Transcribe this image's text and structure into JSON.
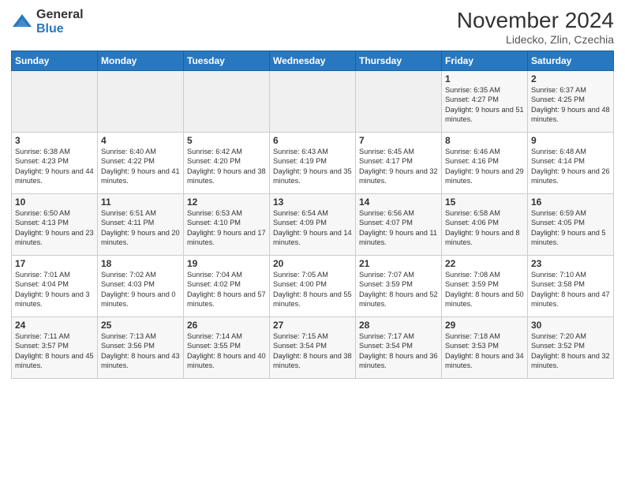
{
  "logo": {
    "general": "General",
    "blue": "Blue"
  },
  "title": "November 2024",
  "subtitle": "Lidecko, Zlin, Czechia",
  "days_of_week": [
    "Sunday",
    "Monday",
    "Tuesday",
    "Wednesday",
    "Thursday",
    "Friday",
    "Saturday"
  ],
  "weeks": [
    [
      {
        "day": "",
        "info": ""
      },
      {
        "day": "",
        "info": ""
      },
      {
        "day": "",
        "info": ""
      },
      {
        "day": "",
        "info": ""
      },
      {
        "day": "",
        "info": ""
      },
      {
        "day": "1",
        "info": "Sunrise: 6:35 AM\nSunset: 4:27 PM\nDaylight: 9 hours and 51 minutes."
      },
      {
        "day": "2",
        "info": "Sunrise: 6:37 AM\nSunset: 4:25 PM\nDaylight: 9 hours and 48 minutes."
      }
    ],
    [
      {
        "day": "3",
        "info": "Sunrise: 6:38 AM\nSunset: 4:23 PM\nDaylight: 9 hours and 44 minutes."
      },
      {
        "day": "4",
        "info": "Sunrise: 6:40 AM\nSunset: 4:22 PM\nDaylight: 9 hours and 41 minutes."
      },
      {
        "day": "5",
        "info": "Sunrise: 6:42 AM\nSunset: 4:20 PM\nDaylight: 9 hours and 38 minutes."
      },
      {
        "day": "6",
        "info": "Sunrise: 6:43 AM\nSunset: 4:19 PM\nDaylight: 9 hours and 35 minutes."
      },
      {
        "day": "7",
        "info": "Sunrise: 6:45 AM\nSunset: 4:17 PM\nDaylight: 9 hours and 32 minutes."
      },
      {
        "day": "8",
        "info": "Sunrise: 6:46 AM\nSunset: 4:16 PM\nDaylight: 9 hours and 29 minutes."
      },
      {
        "day": "9",
        "info": "Sunrise: 6:48 AM\nSunset: 4:14 PM\nDaylight: 9 hours and 26 minutes."
      }
    ],
    [
      {
        "day": "10",
        "info": "Sunrise: 6:50 AM\nSunset: 4:13 PM\nDaylight: 9 hours and 23 minutes."
      },
      {
        "day": "11",
        "info": "Sunrise: 6:51 AM\nSunset: 4:11 PM\nDaylight: 9 hours and 20 minutes."
      },
      {
        "day": "12",
        "info": "Sunrise: 6:53 AM\nSunset: 4:10 PM\nDaylight: 9 hours and 17 minutes."
      },
      {
        "day": "13",
        "info": "Sunrise: 6:54 AM\nSunset: 4:09 PM\nDaylight: 9 hours and 14 minutes."
      },
      {
        "day": "14",
        "info": "Sunrise: 6:56 AM\nSunset: 4:07 PM\nDaylight: 9 hours and 11 minutes."
      },
      {
        "day": "15",
        "info": "Sunrise: 6:58 AM\nSunset: 4:06 PM\nDaylight: 9 hours and 8 minutes."
      },
      {
        "day": "16",
        "info": "Sunrise: 6:59 AM\nSunset: 4:05 PM\nDaylight: 9 hours and 5 minutes."
      }
    ],
    [
      {
        "day": "17",
        "info": "Sunrise: 7:01 AM\nSunset: 4:04 PM\nDaylight: 9 hours and 3 minutes."
      },
      {
        "day": "18",
        "info": "Sunrise: 7:02 AM\nSunset: 4:03 PM\nDaylight: 9 hours and 0 minutes."
      },
      {
        "day": "19",
        "info": "Sunrise: 7:04 AM\nSunset: 4:02 PM\nDaylight: 8 hours and 57 minutes."
      },
      {
        "day": "20",
        "info": "Sunrise: 7:05 AM\nSunset: 4:00 PM\nDaylight: 8 hours and 55 minutes."
      },
      {
        "day": "21",
        "info": "Sunrise: 7:07 AM\nSunset: 3:59 PM\nDaylight: 8 hours and 52 minutes."
      },
      {
        "day": "22",
        "info": "Sunrise: 7:08 AM\nSunset: 3:59 PM\nDaylight: 8 hours and 50 minutes."
      },
      {
        "day": "23",
        "info": "Sunrise: 7:10 AM\nSunset: 3:58 PM\nDaylight: 8 hours and 47 minutes."
      }
    ],
    [
      {
        "day": "24",
        "info": "Sunrise: 7:11 AM\nSunset: 3:57 PM\nDaylight: 8 hours and 45 minutes."
      },
      {
        "day": "25",
        "info": "Sunrise: 7:13 AM\nSunset: 3:56 PM\nDaylight: 8 hours and 43 minutes."
      },
      {
        "day": "26",
        "info": "Sunrise: 7:14 AM\nSunset: 3:55 PM\nDaylight: 8 hours and 40 minutes."
      },
      {
        "day": "27",
        "info": "Sunrise: 7:15 AM\nSunset: 3:54 PM\nDaylight: 8 hours and 38 minutes."
      },
      {
        "day": "28",
        "info": "Sunrise: 7:17 AM\nSunset: 3:54 PM\nDaylight: 8 hours and 36 minutes."
      },
      {
        "day": "29",
        "info": "Sunrise: 7:18 AM\nSunset: 3:53 PM\nDaylight: 8 hours and 34 minutes."
      },
      {
        "day": "30",
        "info": "Sunrise: 7:20 AM\nSunset: 3:52 PM\nDaylight: 8 hours and 32 minutes."
      }
    ]
  ]
}
